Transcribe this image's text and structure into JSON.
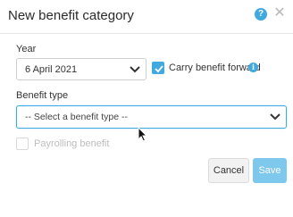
{
  "dialog": {
    "title": "New benefit category"
  },
  "year": {
    "label": "Year",
    "value": "6 April 2021"
  },
  "carry_forward": {
    "label": "Carry benefit forward",
    "checked": true
  },
  "benefit_type": {
    "label": "Benefit type",
    "value": "-- Select a benefit type --"
  },
  "payrolling": {
    "label": "Payrolling benefit",
    "checked": false,
    "disabled": true
  },
  "buttons": {
    "cancel": "Cancel",
    "save": "Save"
  },
  "colors": {
    "accent": "#3fa9e0",
    "save_disabled": "#7ec8ee"
  },
  "icons": [
    "help-icon",
    "close-icon",
    "chevron-down-icon",
    "check-icon",
    "info-icon",
    "mouse-cursor-icon"
  ]
}
